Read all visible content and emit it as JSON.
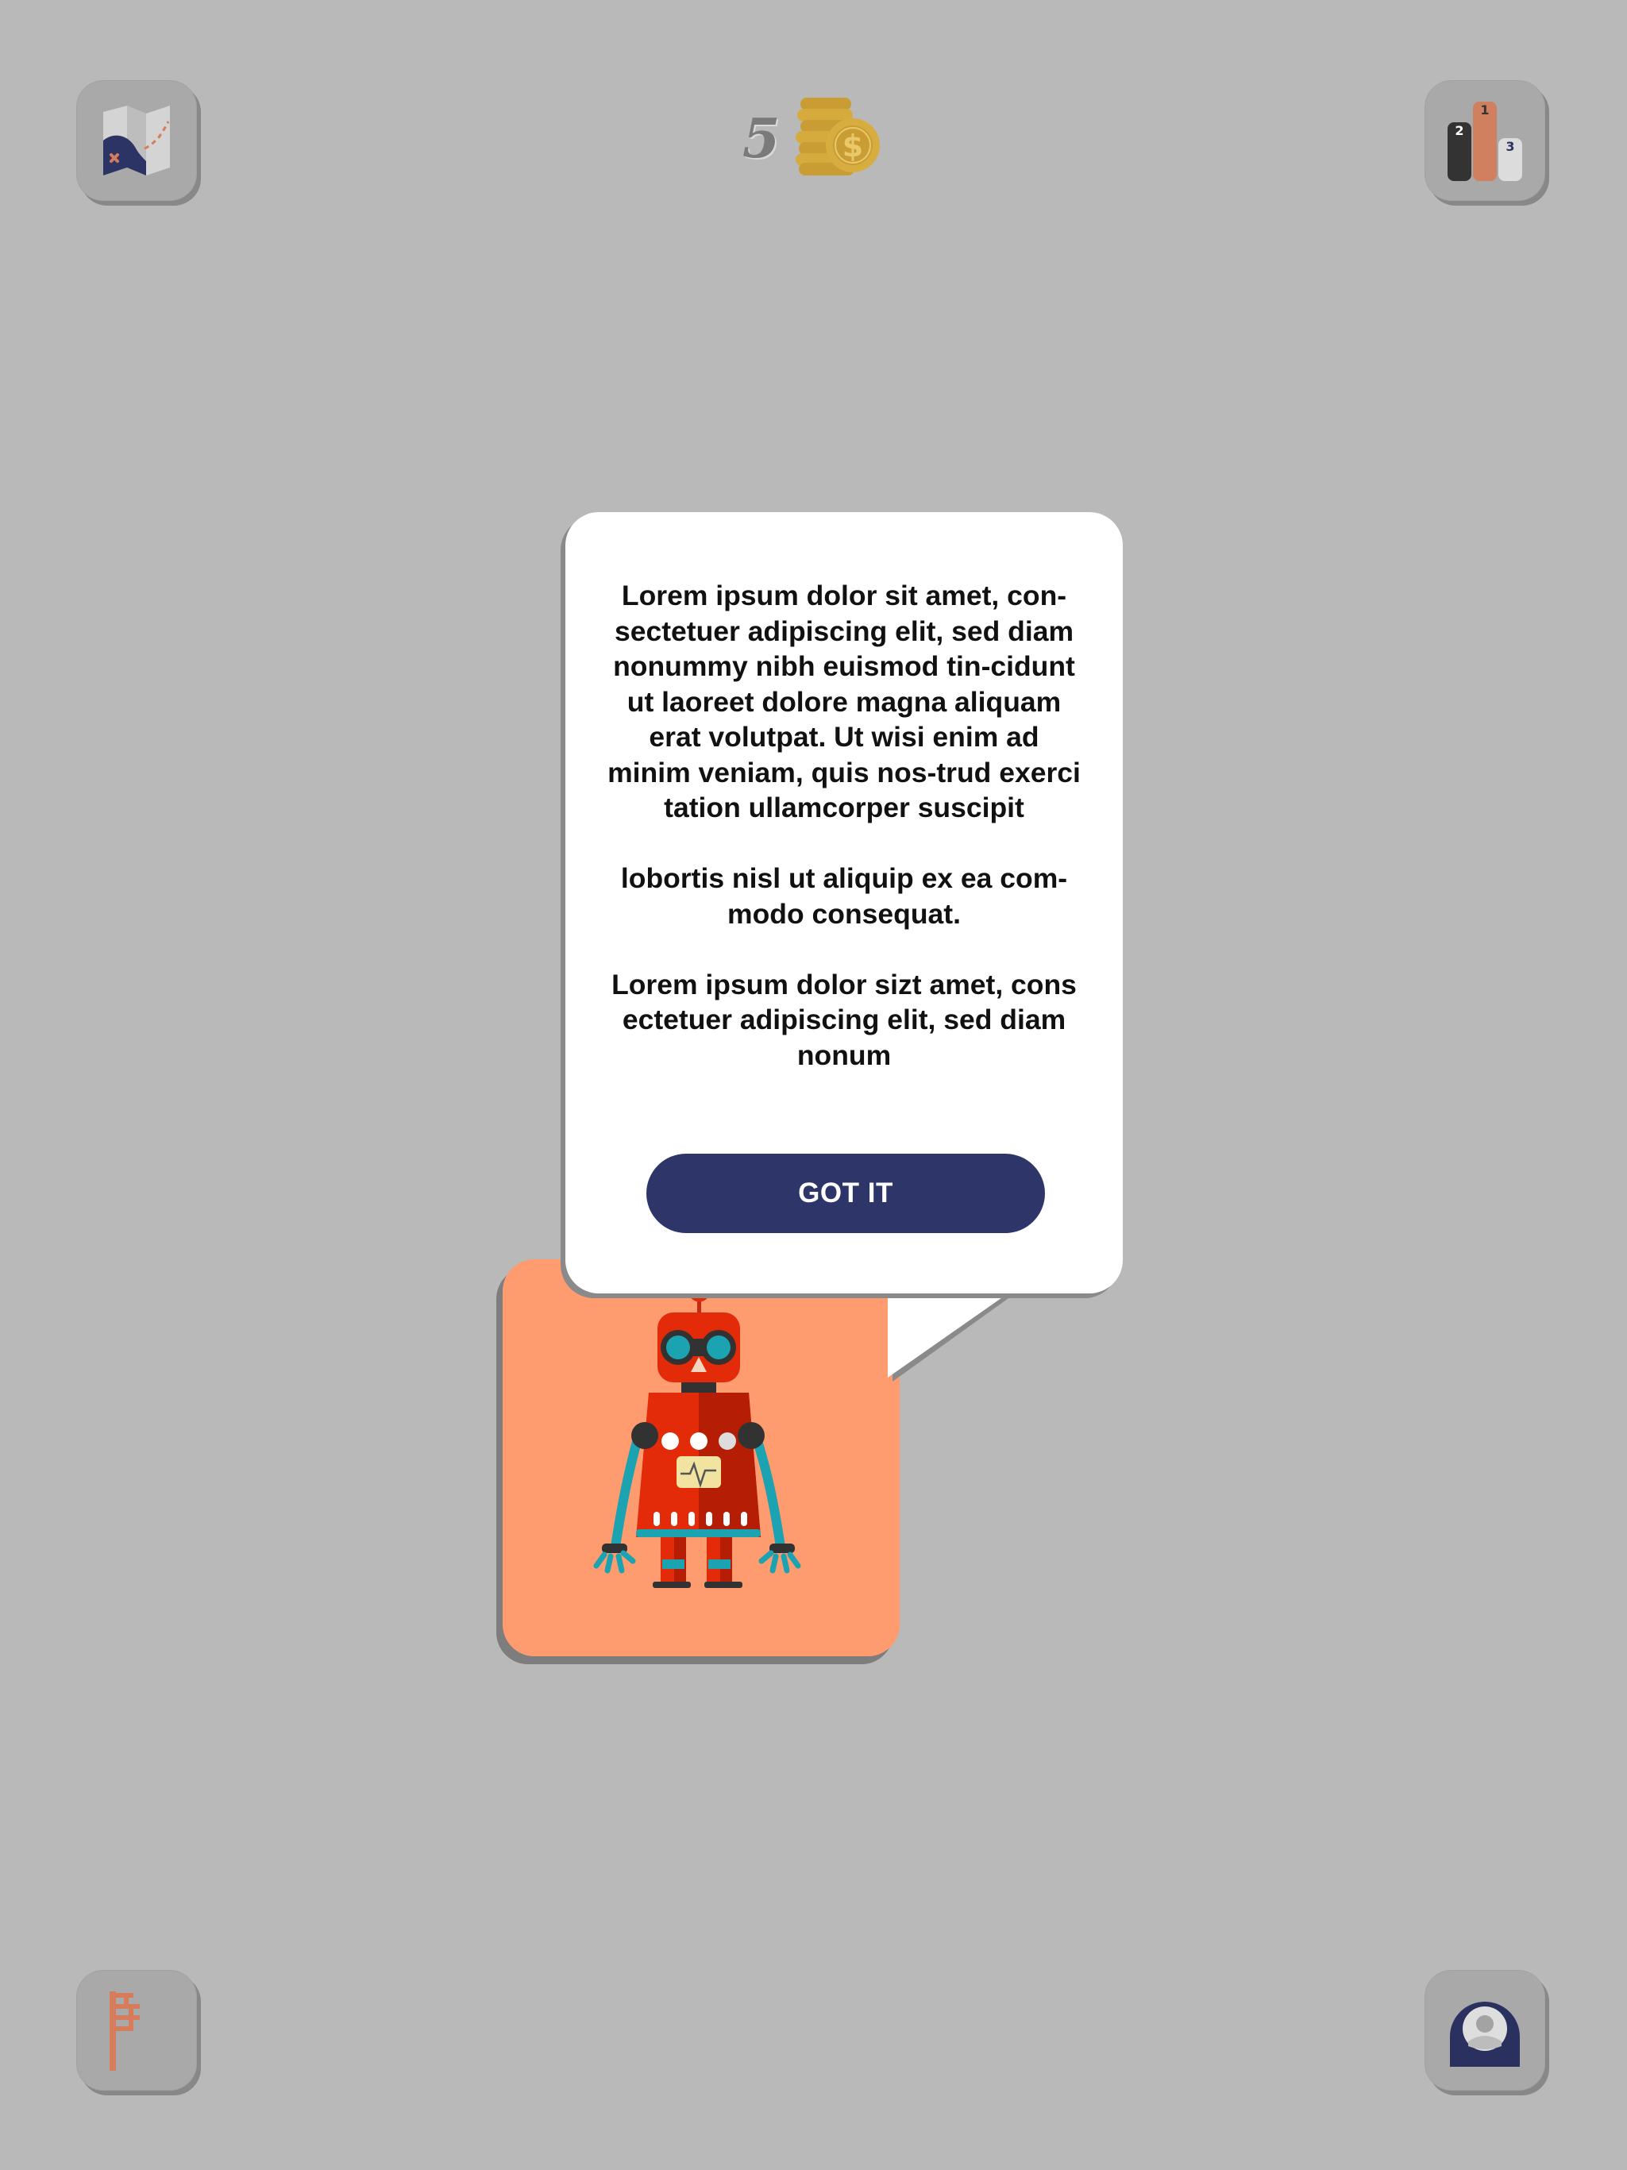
{
  "hud": {
    "coin_count": "5",
    "icons": {
      "map": "map-icon",
      "leaderboard": "podium-icon",
      "coins": "coin-stack-icon",
      "flag": "flag-icon",
      "profile": "profile-icon"
    },
    "podium_labels": [
      "2",
      "1",
      "3"
    ]
  },
  "dialog": {
    "paragraphs": [
      "Lorem ipsum dolor sit amet, con-sectetuer adipiscing elit, sed diam nonummy nibh euismod tin-cidunt ut laoreet dolore magna aliquam erat volutpat. Ut wisi enim ad minim veniam, quis nos-trud exerci tation ullamcorper suscipit",
      "lobortis nisl ut aliquip ex ea com-modo consequat.",
      "Lorem ipsum dolor sizt amet, cons ectetuer adipiscing elit, sed diam nonum"
    ],
    "button_label": "GOT IT"
  },
  "character": {
    "name_icon": "robot-icon"
  },
  "colors": {
    "background": "#b9b9b9",
    "button_tile": "#a9a9a9",
    "accent_orange": "#d77c5b",
    "navy": "#2e3669",
    "robot_card": "#fe9b6f",
    "robot_red": "#e32a09",
    "robot_teal": "#1ba3b1",
    "coin_gold": "#c9a23a"
  }
}
